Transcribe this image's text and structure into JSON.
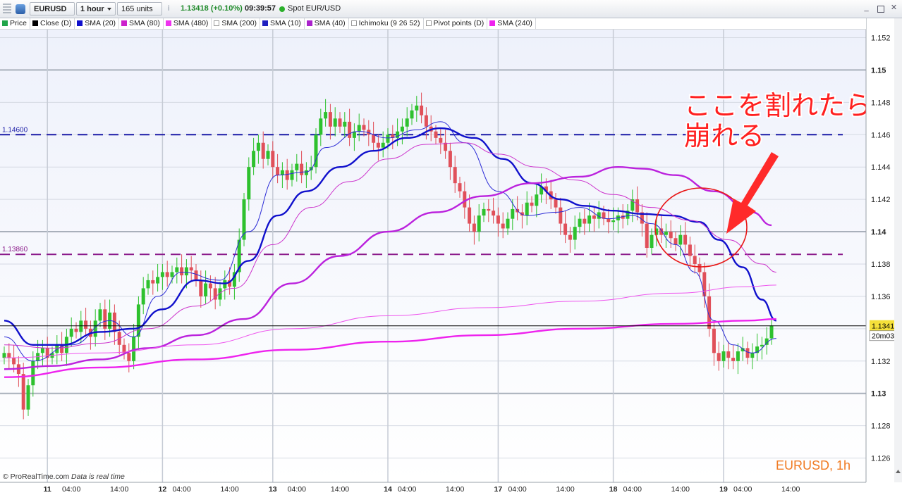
{
  "toolbar": {
    "symbol": "EURUSD",
    "timeframe": "1 hour",
    "units": "165 units",
    "price": "1.13418 (+0.10%)",
    "time": "09:39:57",
    "instrument": "Spot EUR/USD",
    "status_color": "#2bb02b"
  },
  "legend": [
    {
      "label": "Price",
      "color": "#21a54a"
    },
    {
      "label": "Close (D)",
      "color": "#000000"
    },
    {
      "label": "SMA (20)",
      "color": "#1010cc"
    },
    {
      "label": "SMA (80)",
      "color": "#cc22cc"
    },
    {
      "label": "SMA (480)",
      "color": "#ee33ee"
    },
    {
      "label": "SMA (200)",
      "color": "#cfcfcf"
    },
    {
      "label": "SMA (10)",
      "color": "#2020c0"
    },
    {
      "label": "SMA (40)",
      "color": "#aa22cc"
    },
    {
      "label": "Ichimoku (9 26 52)",
      "color": "#cfcfcf"
    },
    {
      "label": "Pivot points (D)",
      "color": "#cfcfcf"
    },
    {
      "label": "SMA (240)",
      "color": "#ee22ee"
    }
  ],
  "footer": {
    "copyright": "© ProRealTime.com",
    "realtime": "Data is real time",
    "instrument_label": "EURUSD, 1h"
  },
  "annotation": {
    "line1": "ここを割れたら",
    "line2": "崩れる"
  },
  "chart_data": {
    "type": "candlestick",
    "ylim": [
      1.1245,
      1.1525
    ],
    "yticks": [
      {
        "value": 1.126,
        "label": "1.126"
      },
      {
        "value": 1.128,
        "label": "1.128"
      },
      {
        "value": 1.13,
        "label": "1.13",
        "bold": true
      },
      {
        "value": 1.132,
        "label": "1.132"
      },
      {
        "value": 1.134,
        "label": ""
      },
      {
        "value": 1.136,
        "label": "1.136"
      },
      {
        "value": 1.138,
        "label": "1.138"
      },
      {
        "value": 1.14,
        "label": "1.14",
        "bold": true
      },
      {
        "value": 1.142,
        "label": "1.142"
      },
      {
        "value": 1.144,
        "label": "1.144"
      },
      {
        "value": 1.146,
        "label": "1.146"
      },
      {
        "value": 1.148,
        "label": "1.148"
      },
      {
        "value": 1.15,
        "label": "1.15",
        "bold": true
      },
      {
        "value": 1.152,
        "label": "1.152"
      }
    ],
    "xticks": [
      {
        "bar": 9,
        "label": "11",
        "bold": true
      },
      {
        "bar": 14,
        "label": "04:00"
      },
      {
        "bar": 24,
        "label": "14:00"
      },
      {
        "bar": 33,
        "label": "12",
        "bold": true
      },
      {
        "bar": 37,
        "label": "04:00"
      },
      {
        "bar": 47,
        "label": "14:00"
      },
      {
        "bar": 56,
        "label": "13",
        "bold": true
      },
      {
        "bar": 61,
        "label": "04:00"
      },
      {
        "bar": 70,
        "label": "14:00"
      },
      {
        "bar": 80,
        "label": "14",
        "bold": true
      },
      {
        "bar": 84,
        "label": "04:00"
      },
      {
        "bar": 94,
        "label": "14:00"
      },
      {
        "bar": 103,
        "label": "17",
        "bold": true
      },
      {
        "bar": 107,
        "label": "04:00"
      },
      {
        "bar": 117,
        "label": "14:00"
      },
      {
        "bar": 127,
        "label": "18",
        "bold": true
      },
      {
        "bar": 131,
        "label": "04:00"
      },
      {
        "bar": 141,
        "label": "14:00"
      },
      {
        "bar": 150,
        "label": "19",
        "bold": true
      },
      {
        "bar": 154,
        "label": "04:00"
      },
      {
        "bar": 164,
        "label": "14:00"
      }
    ],
    "last_price": {
      "value": 1.13418,
      "label": "1.13418",
      "countdown": "20m03s"
    },
    "hlines": [
      {
        "value": 1.146,
        "label": "1.14600",
        "color": "#1a1aa6"
      },
      {
        "value": 1.1386,
        "label": "1.13860",
        "color": "#8a1a8a"
      }
    ],
    "closes": [
      1.1325,
      1.1322,
      1.1318,
      1.1312,
      1.129,
      1.1305,
      1.132,
      1.1325,
      1.1328,
      1.1322,
      1.1325,
      1.133,
      1.1325,
      1.1335,
      1.134,
      1.1338,
      1.1345,
      1.134,
      1.1335,
      1.1345,
      1.1352,
      1.134,
      1.135,
      1.1338,
      1.133,
      1.1325,
      1.132,
      1.1335,
      1.1355,
      1.1365,
      1.137,
      1.1368,
      1.1372,
      1.1375,
      1.1372,
      1.1375,
      1.1378,
      1.1373,
      1.1378,
      1.1376,
      1.137,
      1.136,
      1.1368,
      1.1365,
      1.1358,
      1.1365,
      1.137,
      1.1366,
      1.1375,
      1.1395,
      1.142,
      1.144,
      1.145,
      1.1455,
      1.1445,
      1.145,
      1.144,
      1.1435,
      1.1438,
      1.1432,
      1.1438,
      1.1442,
      1.1435,
      1.1438,
      1.144,
      1.146,
      1.147,
      1.1474,
      1.1465,
      1.147,
      1.1465,
      1.1468,
      1.1458,
      1.1462,
      1.1466,
      1.1463,
      1.146,
      1.1455,
      1.1452,
      1.1455,
      1.146,
      1.1458,
      1.1462,
      1.1465,
      1.147,
      1.1475,
      1.1478,
      1.1472,
      1.1465,
      1.1462,
      1.1458,
      1.1455,
      1.145,
      1.144,
      1.143,
      1.1425,
      1.1415,
      1.1405,
      1.14,
      1.141,
      1.1414,
      1.1413,
      1.141,
      1.1405,
      1.1402,
      1.1408,
      1.1414,
      1.1412,
      1.141,
      1.1418,
      1.1416,
      1.1423,
      1.1428,
      1.1425,
      1.142,
      1.1415,
      1.1405,
      1.1398,
      1.1395,
      1.1403,
      1.1408,
      1.1405,
      1.141,
      1.1408,
      1.1412,
      1.1408,
      1.1406,
      1.1407,
      1.141,
      1.1408,
      1.1413,
      1.142,
      1.1412,
      1.1405,
      1.139,
      1.1398,
      1.1402,
      1.1398,
      1.14,
      1.1396,
      1.1392,
      1.1398,
      1.1392,
      1.1385,
      1.138,
      1.1375,
      1.136,
      1.134,
      1.1325,
      1.132,
      1.1326,
      1.1322,
      1.132,
      1.1326,
      1.1328,
      1.1322,
      1.1325,
      1.1329,
      1.133,
      1.1334,
      1.1342
    ],
    "sma": [
      {
        "name": "SMA (10)",
        "color": "#2b2bd6",
        "width": 1,
        "points": [
          [
            0,
            1.1335
          ],
          [
            6,
            1.132
          ],
          [
            14,
            1.133
          ],
          [
            22,
            1.1345
          ],
          [
            27,
            1.1335
          ],
          [
            32,
            1.136
          ],
          [
            37,
            1.1375
          ],
          [
            45,
            1.137
          ],
          [
            51,
            1.14
          ],
          [
            57,
            1.1435
          ],
          [
            63,
            1.1437
          ],
          [
            67,
            1.1452
          ],
          [
            74,
            1.1462
          ],
          [
            80,
            1.1458
          ],
          [
            86,
            1.1463
          ],
          [
            91,
            1.1468
          ],
          [
            96,
            1.1455
          ],
          [
            103,
            1.1425
          ],
          [
            109,
            1.141
          ],
          [
            115,
            1.1412
          ],
          [
            120,
            1.1415
          ],
          [
            126,
            1.1408
          ],
          [
            131,
            1.141
          ],
          [
            135,
            1.1405
          ],
          [
            140,
            1.1392
          ],
          [
            144,
            1.1375
          ],
          [
            148,
            1.1345
          ],
          [
            152,
            1.133
          ],
          [
            156,
            1.1325
          ],
          [
            161,
            1.1334
          ]
        ]
      },
      {
        "name": "SMA (20)",
        "color": "#1010cc",
        "width": 2.4,
        "points": [
          [
            0,
            1.1345
          ],
          [
            6,
            1.133
          ],
          [
            12,
            1.133
          ],
          [
            20,
            1.1338
          ],
          [
            27,
            1.134
          ],
          [
            33,
            1.1352
          ],
          [
            40,
            1.137
          ],
          [
            46,
            1.1368
          ],
          [
            51,
            1.1382
          ],
          [
            57,
            1.141
          ],
          [
            63,
            1.1425
          ],
          [
            70,
            1.144
          ],
          [
            77,
            1.145
          ],
          [
            84,
            1.1458
          ],
          [
            91,
            1.1464
          ],
          [
            98,
            1.1458
          ],
          [
            104,
            1.1445
          ],
          [
            110,
            1.143
          ],
          [
            116,
            1.142
          ],
          [
            121,
            1.1416
          ],
          [
            127,
            1.1413
          ],
          [
            133,
            1.1411
          ],
          [
            139,
            1.141
          ],
          [
            145,
            1.1406
          ],
          [
            149,
            1.1395
          ],
          [
            154,
            1.1378
          ],
          [
            158,
            1.1358
          ],
          [
            161,
            1.1345
          ]
        ]
      },
      {
        "name": "SMA (40)",
        "color": "#cc33cc",
        "width": 1,
        "points": [
          [
            0,
            1.133
          ],
          [
            10,
            1.1328
          ],
          [
            20,
            1.1331
          ],
          [
            30,
            1.134
          ],
          [
            40,
            1.1354
          ],
          [
            48,
            1.1365
          ],
          [
            56,
            1.1392
          ],
          [
            64,
            1.1415
          ],
          [
            72,
            1.1431
          ],
          [
            80,
            1.1445
          ],
          [
            88,
            1.1454
          ],
          [
            96,
            1.1455
          ],
          [
            103,
            1.1448
          ],
          [
            111,
            1.144
          ],
          [
            119,
            1.1432
          ],
          [
            127,
            1.1423
          ],
          [
            135,
            1.1415
          ],
          [
            143,
            1.1407
          ],
          [
            151,
            1.1395
          ],
          [
            158,
            1.138
          ],
          [
            161,
            1.1375
          ]
        ]
      },
      {
        "name": "SMA (80)",
        "color": "#bb22dd",
        "width": 2.4,
        "points": [
          [
            0,
            1.1315
          ],
          [
            10,
            1.1317
          ],
          [
            20,
            1.1321
          ],
          [
            30,
            1.1328
          ],
          [
            40,
            1.1336
          ],
          [
            50,
            1.1346
          ],
          [
            60,
            1.1368
          ],
          [
            70,
            1.1385
          ],
          [
            80,
            1.14
          ],
          [
            90,
            1.1412
          ],
          [
            100,
            1.1422
          ],
          [
            110,
            1.143
          ],
          [
            120,
            1.1434
          ],
          [
            128,
            1.144
          ],
          [
            133,
            1.1439
          ],
          [
            140,
            1.1435
          ],
          [
            148,
            1.1425
          ],
          [
            156,
            1.1412
          ],
          [
            160,
            1.1404
          ]
        ]
      },
      {
        "name": "SMA (480)",
        "color": "#ee55ee",
        "width": 1,
        "points": [
          [
            0,
            1.1322
          ],
          [
            20,
            1.1325
          ],
          [
            40,
            1.133
          ],
          [
            60,
            1.134
          ],
          [
            80,
            1.1348
          ],
          [
            100,
            1.1353
          ],
          [
            120,
            1.1357
          ],
          [
            140,
            1.1362
          ],
          [
            155,
            1.1366
          ],
          [
            161,
            1.1367
          ]
        ]
      },
      {
        "name": "SMA (240)",
        "color": "#ee22ee",
        "width": 2.4,
        "points": [
          [
            0,
            1.131
          ],
          [
            20,
            1.1316
          ],
          [
            40,
            1.1321
          ],
          [
            60,
            1.1327
          ],
          [
            80,
            1.1332
          ],
          [
            100,
            1.1336
          ],
          [
            120,
            1.134
          ],
          [
            140,
            1.1343
          ],
          [
            155,
            1.1345
          ],
          [
            161,
            1.1346
          ]
        ]
      }
    ]
  }
}
